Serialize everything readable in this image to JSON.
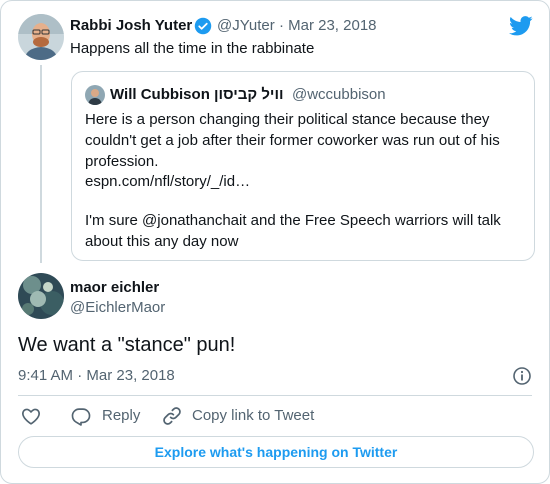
{
  "parent_tweet": {
    "author_name": "Rabbi Josh Yuter",
    "author_handle": "@JYuter",
    "separator": "·",
    "date": "Mar 23, 2018",
    "text": "Happens all the time in the rabbinate"
  },
  "quoted_tweet": {
    "author_name": "Will Cubbison וויל קביסון",
    "author_handle": "@wccubbison",
    "text_line1": "Here is a person changing their political stance because they",
    "text_line2": "couldn't get a job after their former coworker was run out of his",
    "text_line3": "profession.",
    "link": "espn.com/nfl/story/_/id…",
    "text_line4": "I'm sure @jonathanchait and the Free Speech warriors will talk",
    "text_line5": "about this any day now"
  },
  "main_tweet": {
    "author_name": "maor eichler",
    "author_handle": "@EichlerMaor",
    "text": "We want a \"stance\" pun!",
    "time": "9:41 AM",
    "separator": "·",
    "date": "Mar 23, 2018"
  },
  "actions": {
    "reply_label": "Reply",
    "copy_label": "Copy link to Tweet"
  },
  "explore_label": "Explore what's happening on Twitter",
  "colors": {
    "accent": "#1d9bf0",
    "secondary_text": "#536471",
    "border": "#cfd9de",
    "verified": "#1d9bf0"
  },
  "icons": [
    "twitter-bird-icon",
    "verified-badge-icon",
    "info-icon",
    "heart-icon",
    "reply-icon",
    "link-icon"
  ]
}
